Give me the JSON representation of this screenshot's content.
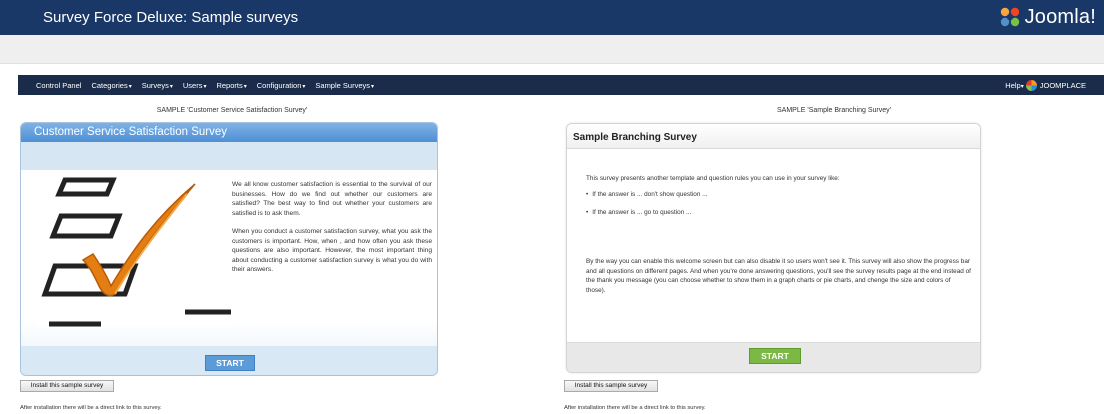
{
  "header": {
    "title": "Survey Force Deluxe: Sample surveys",
    "logo_text": "Joomla!"
  },
  "nav": {
    "items": [
      {
        "label": "Control Panel",
        "dropdown": false
      },
      {
        "label": "Categories",
        "dropdown": true
      },
      {
        "label": "Surveys",
        "dropdown": true
      },
      {
        "label": "Users",
        "dropdown": true
      },
      {
        "label": "Reports",
        "dropdown": true
      },
      {
        "label": "Configuration",
        "dropdown": true
      },
      {
        "label": "Sample Surveys",
        "dropdown": true
      }
    ],
    "help_label": "Help",
    "brand_label": "JOOMPLACE"
  },
  "left": {
    "heading": "SAMPLE 'Customer Service Satisfaction Survey'",
    "card_title": "Customer Service Satisfaction Survey",
    "paragraph1": "We all know customer satisfaction is essential to the survival of our businesses. How do we find out whether our customers are satisfied? The best way to find out whether your customers are satisfied is to ask them.",
    "paragraph2": "When you conduct a customer satisfaction survey, what you ask the customers is important. How, when , and how often you ask these questions are also important. However, the most important thing about conducting a customer satisfaction survey is what you do with their answers.",
    "start_label": "START",
    "install_label": "Install this sample survey",
    "note": "After installation there will be a direct link to this survey."
  },
  "right": {
    "heading": "SAMPLE 'Sample Branching Survey'",
    "card_title": "Sample Branching Survey",
    "intro": "This survey presents another template and question rules you can use in your survey like:",
    "bullets": [
      "If the answer is ... don't show question ...",
      "If the answer is ... go to question ..."
    ],
    "paragraph": "By the way you can enable this welcome screen but can also disable it so users won't see it. This survey will also show the progress bar and all questions on different pages. And when you're done answering questions, you'll see the survey results page at the end instead of the thank you message (you can choose whether to show them in a graph charts or pie charts, and chenge the size and colors of those).",
    "start_label": "START",
    "install_label": "Install this sample survey",
    "note": "After installation there will be a direct link to this survey."
  },
  "colors": {
    "header_bg": "#1a3867",
    "nav_bg": "#1b2c4b",
    "left_start": "#5b9bd8",
    "right_start": "#7bb844"
  }
}
